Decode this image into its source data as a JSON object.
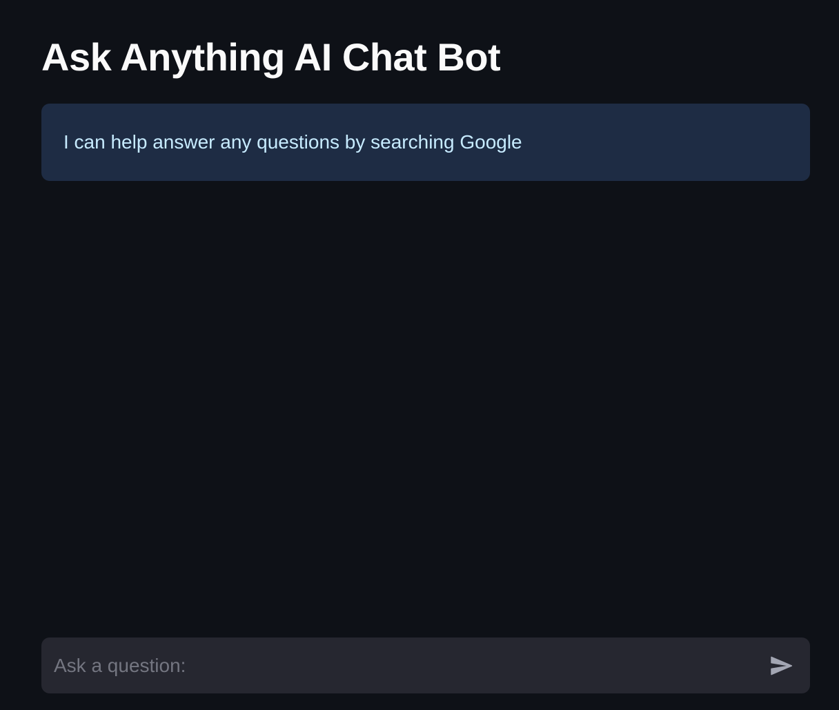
{
  "page": {
    "title": "Ask Anything AI Chat Bot"
  },
  "info": {
    "message": "I can help answer any questions by searching Google"
  },
  "chat_input": {
    "placeholder": "Ask a question:",
    "value": "",
    "send_icon": "send-icon"
  },
  "colors": {
    "background": "#0e1117",
    "title_text": "#fafafa",
    "info_background": "#1e2c44",
    "info_text": "#c7ebff",
    "input_background": "#262730",
    "placeholder_text": "#747681",
    "send_icon": "#a3a6b3"
  }
}
